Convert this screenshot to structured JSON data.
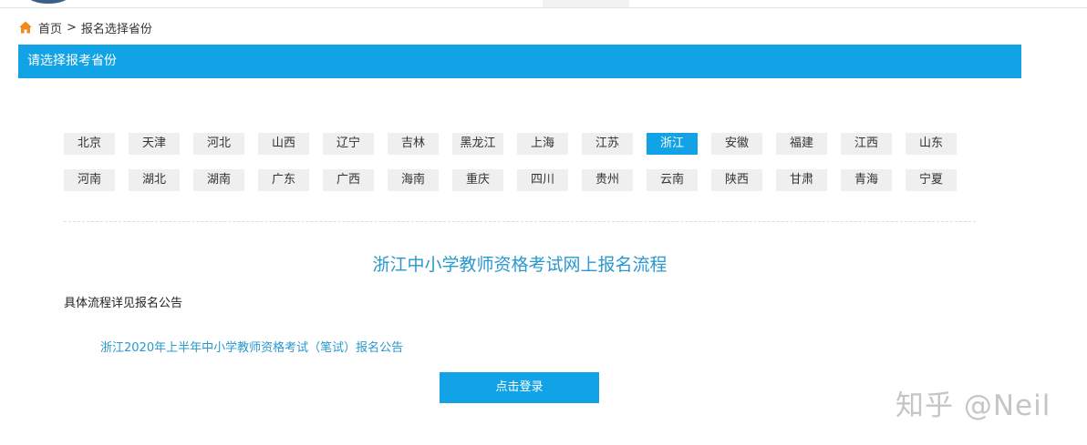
{
  "breadcrumb": {
    "home_label": "首页",
    "separator": ">",
    "current": "报名选择省份"
  },
  "header": {
    "title": "请选择报考省份"
  },
  "provinces": {
    "selected": "浙江",
    "row1": [
      "北京",
      "天津",
      "河北",
      "山西",
      "辽宁",
      "吉林",
      "黑龙江",
      "上海",
      "江苏",
      "浙江",
      "安徽",
      "福建",
      "江西",
      "山东"
    ],
    "row2": [
      "河南",
      "湖北",
      "湖南",
      "广东",
      "广西",
      "海南",
      "重庆",
      "四川",
      "贵州",
      "云南",
      "陕西",
      "甘肃",
      "青海",
      "宁夏"
    ]
  },
  "process": {
    "title": "浙江中小学教师资格考试网上报名流程",
    "detail_note": "具体流程详见报名公告",
    "notice_link": "浙江2020年上半年中小学教师资格考试（笔试）报名公告"
  },
  "login_button": "点击登录",
  "watermark": "知乎 @Neil",
  "colors": {
    "accent": "#11a3e6",
    "link": "#2898cf",
    "button_bg": "#efefef"
  },
  "icons": {
    "home": "home-icon"
  }
}
